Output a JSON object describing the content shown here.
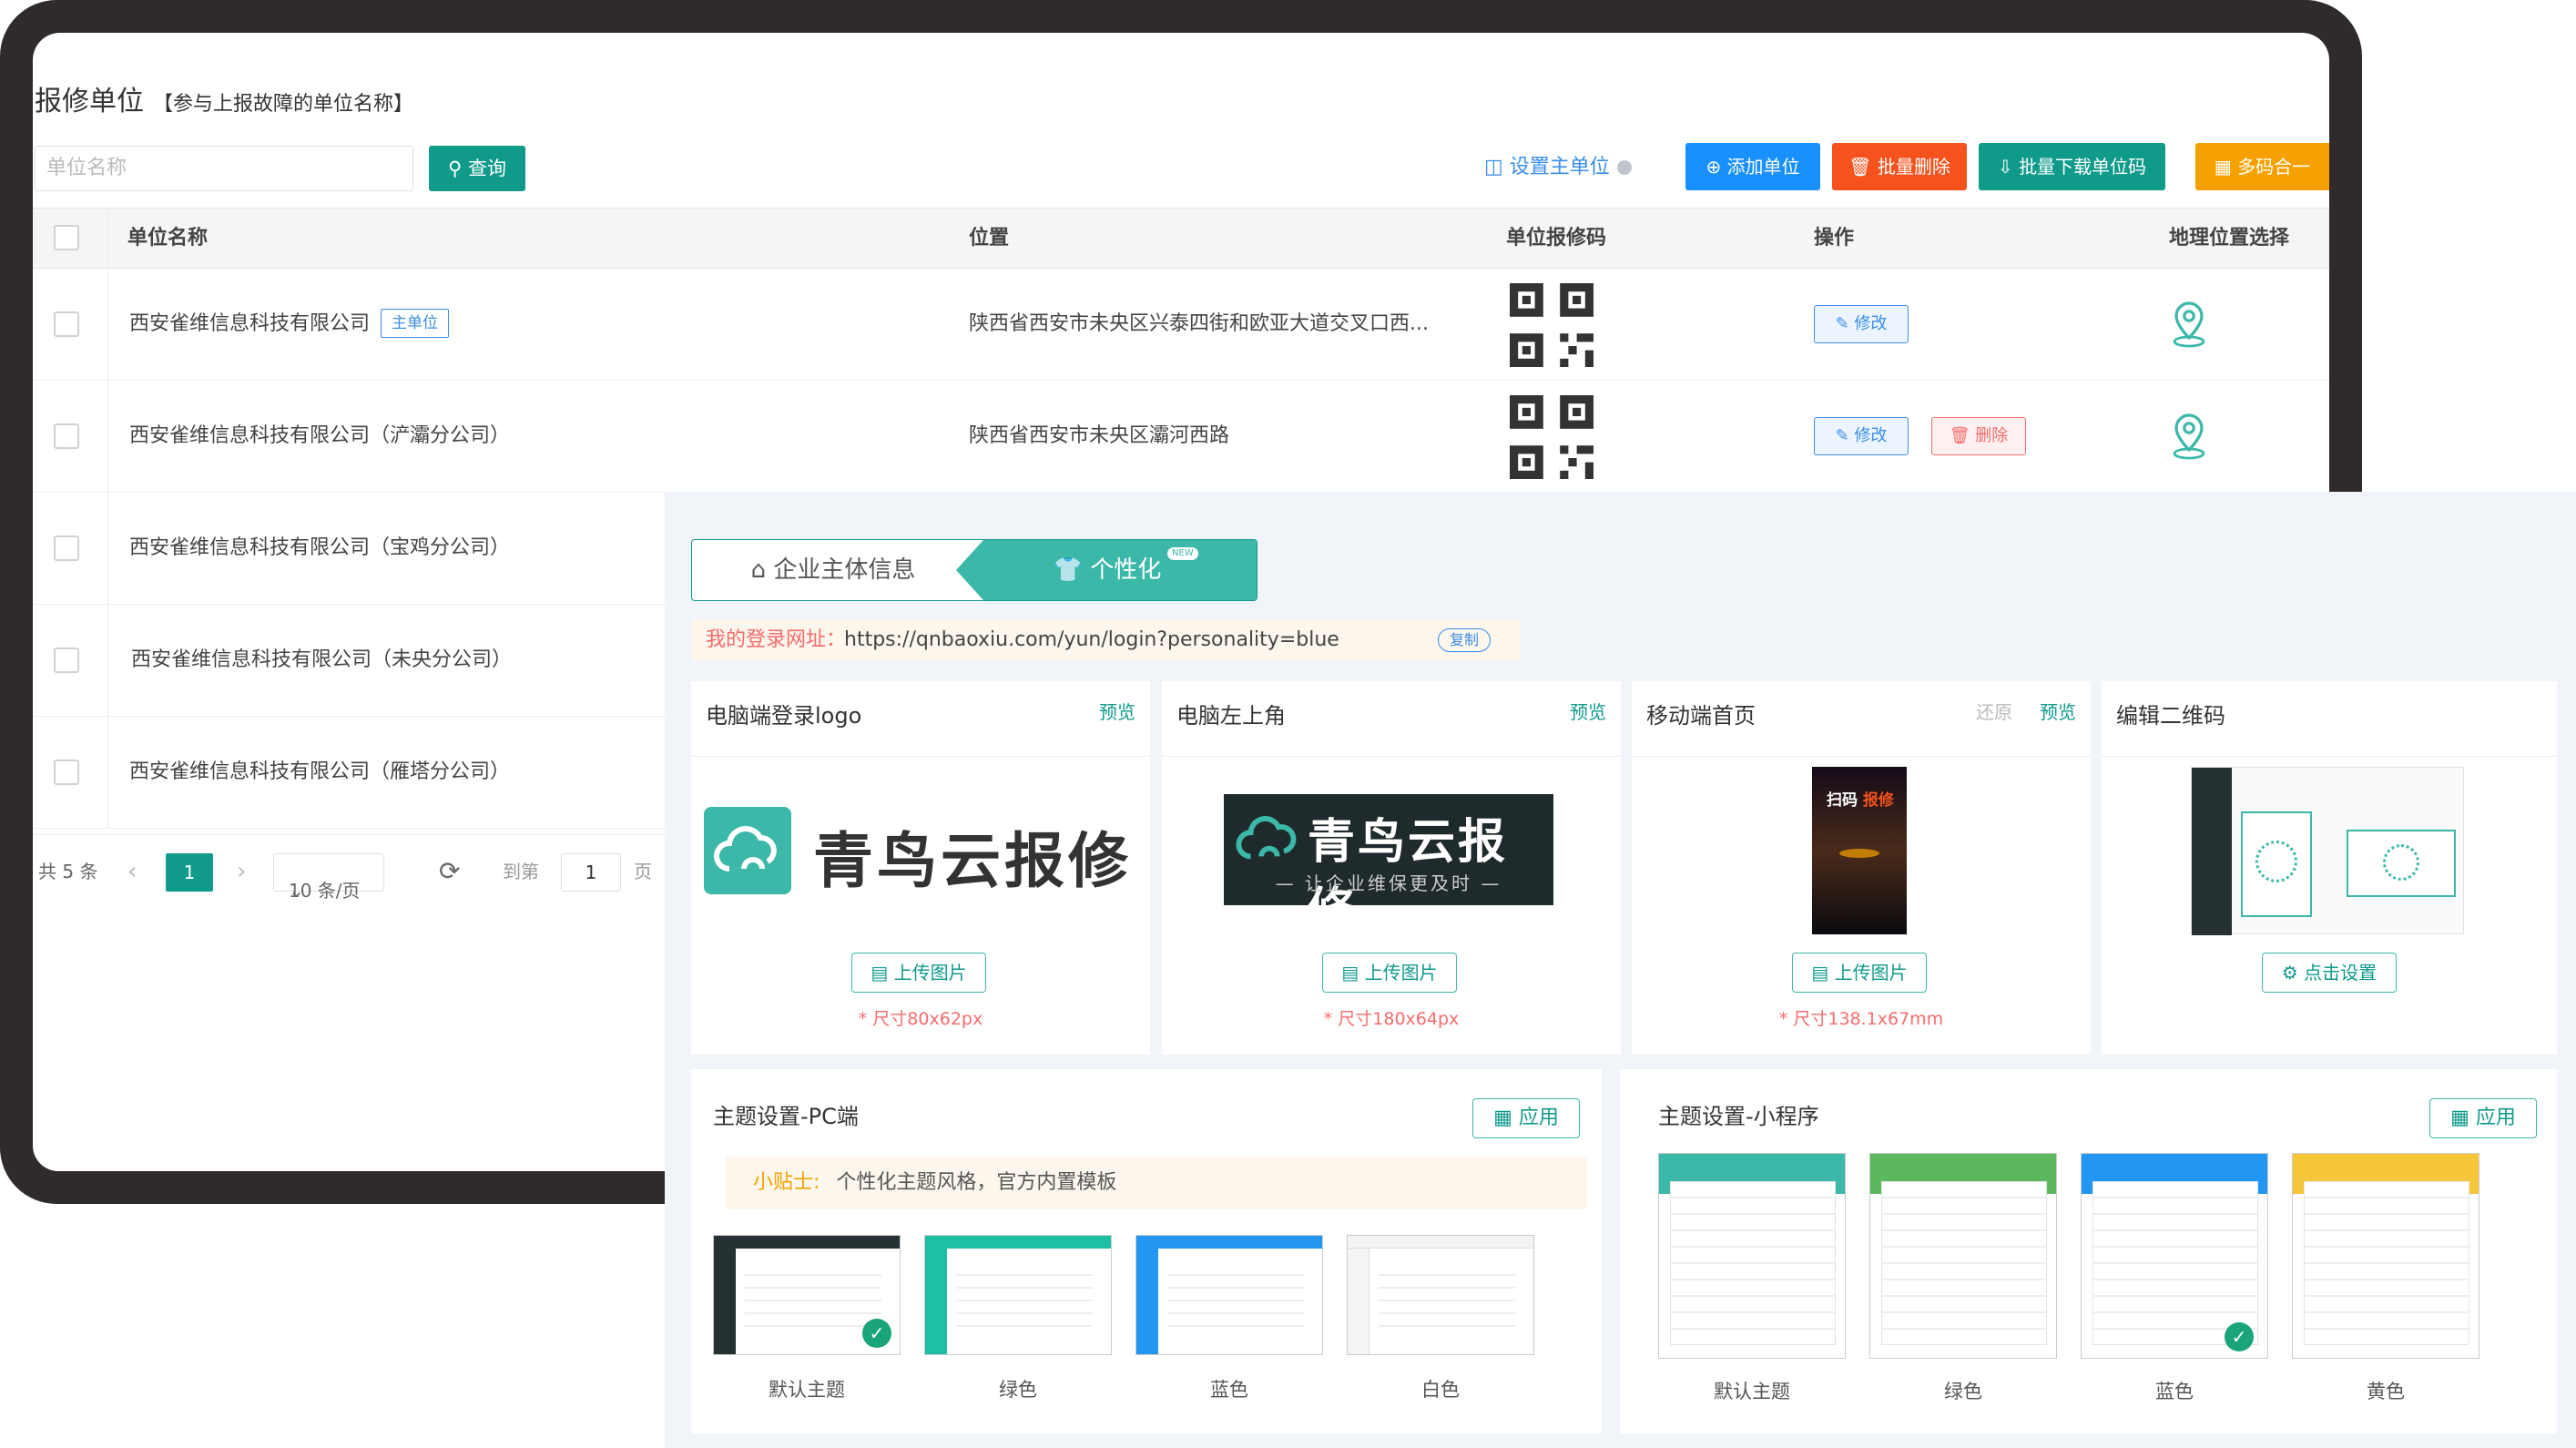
{
  "header": {
    "title": "报修单位",
    "subtitle": "【参与上报故障的单位名称】"
  },
  "search": {
    "placeholder": "单位名称",
    "button": "查询"
  },
  "toolbar": {
    "set_main": "设置主单位",
    "add": "添加单位",
    "batch_delete": "批量删除",
    "batch_download": "批量下载单位码",
    "multi_code": "多码合一",
    "colors": {
      "add": "#1890ff",
      "delete": "#f5521d",
      "download": "#0f9a8a",
      "multi": "#f6a100"
    }
  },
  "table": {
    "columns": [
      "单位名称",
      "位置",
      "单位报修码",
      "操作",
      "地理位置选择"
    ],
    "rows": [
      {
        "name": "西安雀维信息科技有限公司",
        "tag": "主单位",
        "location": "陕西省西安市未央区兴泰四街和欧亚大道交叉口西...",
        "actions": [
          "修改"
        ]
      },
      {
        "name": "西安雀维信息科技有限公司（浐灞分公司）",
        "location": "陕西省西安市未央区灞河西路",
        "actions": [
          "修改",
          "删除"
        ]
      },
      {
        "name": "西安雀维信息科技有限公司（宝鸡分公司）"
      },
      {
        "name": "西安雀维信息科技有限公司（未央分公司）"
      },
      {
        "name": "西安雀维信息科技有限公司（雁塔分公司）"
      }
    ]
  },
  "pager": {
    "total": "共 5 条",
    "page": "1",
    "page_size": "10 条/页",
    "goto": "到第",
    "goto_value": "1",
    "unit": "页"
  },
  "personal": {
    "tabs": [
      "企业主体信息",
      "个性化"
    ],
    "new_badge": "NEW",
    "login_url_label": "我的登录网址：",
    "login_url": "https://qnbaoxiu.com/yun/login?personality=blue",
    "copy": "复制",
    "cards": [
      {
        "title": "电脑端登录logo",
        "links": [
          "预览"
        ],
        "button": "上传图片",
        "size": "* 尺寸80x62px",
        "logo_text": "青鸟云报修"
      },
      {
        "title": "电脑左上角",
        "links": [
          "预览"
        ],
        "button": "上传图片",
        "size": "* 尺寸180x64px",
        "logo_text": "青鸟云报修",
        "logo_slogan": "— 让企业维保更及时 —"
      },
      {
        "title": "移动端首页",
        "links": [
          "还原",
          "预览"
        ],
        "button": "上传图片",
        "size": "* 尺寸138.1x67mm",
        "phone_text_a": "扫码",
        "phone_text_b": "报修"
      },
      {
        "title": "编辑二维码",
        "links": [],
        "button": "点击设置"
      }
    ],
    "theme_pc": {
      "title": "主题设置-PC端",
      "apply": "应用",
      "tip_label": "小贴士:",
      "tip": "个性化主题风格，官方内置模板",
      "themes": [
        "默认主题",
        "绿色",
        "蓝色",
        "白色"
      ],
      "selected": "默认主题"
    },
    "theme_mini": {
      "title": "主题设置-小程序",
      "apply": "应用",
      "themes": [
        "默认主题",
        "绿色",
        "蓝色",
        "黄色"
      ],
      "selected": "蓝色"
    },
    "colors": {
      "primary": "#0f9a8a",
      "panel_bg": "#f1f4f9"
    }
  }
}
